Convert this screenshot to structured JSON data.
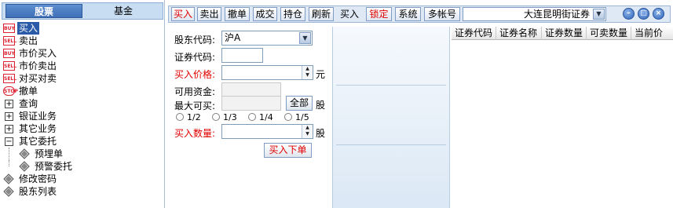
{
  "left_panel": {
    "tabs": {
      "stock": "股票",
      "fund": "基金"
    },
    "tree": [
      {
        "icon": "BUY",
        "label": "买入"
      },
      {
        "icon": "SELL",
        "label": "卖出"
      },
      {
        "icon": "BUY",
        "label": "市价买入"
      },
      {
        "icon": "SELL",
        "label": "市价卖出"
      },
      {
        "icon": "SELL",
        "label": "对买对卖"
      },
      {
        "icon": "STOP",
        "label": "撤单"
      },
      {
        "icon": "plus",
        "label": "查询"
      },
      {
        "icon": "plus",
        "label": "银证业务"
      },
      {
        "icon": "plus",
        "label": "其它业务"
      },
      {
        "icon": "minus",
        "label": "其它委托"
      },
      {
        "icon": "diamond",
        "label": "预埋单"
      },
      {
        "icon": "diamond",
        "label": "预警委托"
      },
      {
        "icon": "diamond",
        "label": "修改密码"
      },
      {
        "icon": "diamond",
        "label": "股东列表"
      }
    ]
  },
  "toolbar": {
    "buttons": [
      "买入",
      "卖出",
      "撤单",
      "成交",
      "持仓",
      "刷新"
    ],
    "current_mode": "买入",
    "lock": "锁定",
    "system": "系统",
    "multi_account": "多帐号",
    "account_name": "大连昆明街证券"
  },
  "order_form": {
    "shareholder_code_label": "股东代码:",
    "shareholder_code_value": "沪A",
    "security_code_label": "证券代码:",
    "security_code_value": "",
    "buy_price_label": "买入价格:",
    "price_unit": "元",
    "available_funds_label": "可用资金:",
    "max_buy_label": "最大可买:",
    "all_button": "全部",
    "shares_unit": "股",
    "fractions": [
      "1/2",
      "1/3",
      "1/4",
      "1/5"
    ],
    "buy_quantity_label": "买入数量:",
    "quantity_unit": "股",
    "submit_button": "买入下单"
  },
  "holdings": {
    "columns": [
      "证券代码",
      "证券名称",
      "证券数量",
      "可卖数量",
      "当前价"
    ]
  },
  "colors": {
    "accent_red": "#e00000",
    "selection_blue": "#2b5ba8",
    "panel_blue": "#dbe8f5"
  }
}
